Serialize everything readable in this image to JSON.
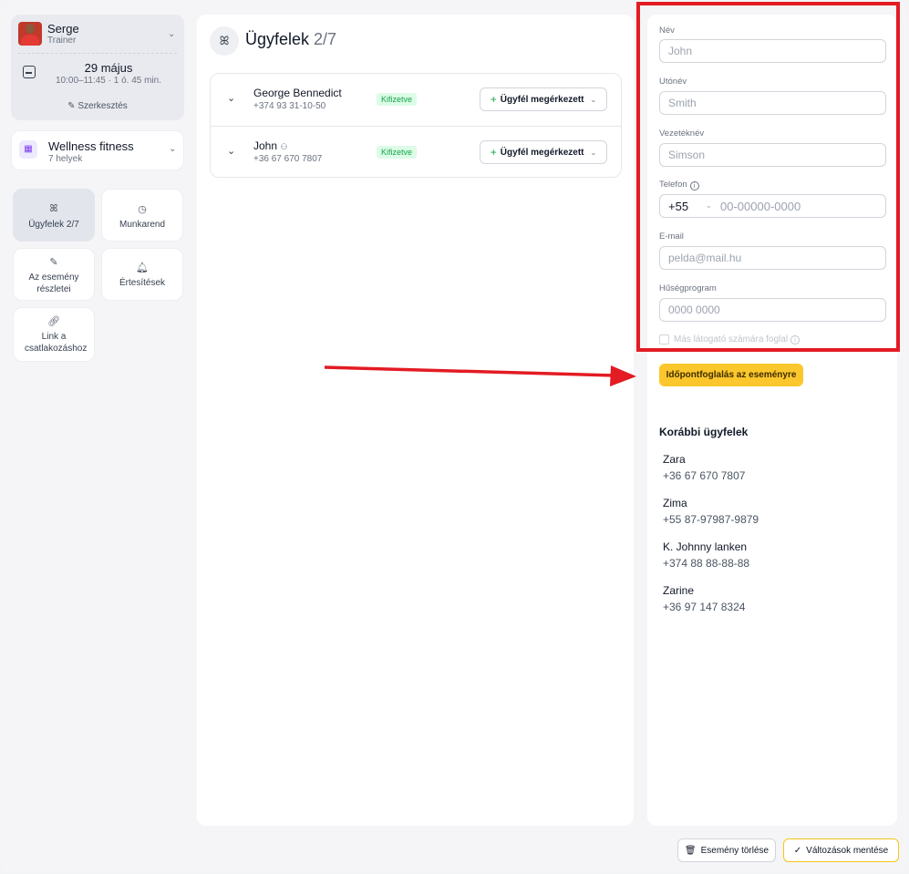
{
  "trainer": {
    "name": "Serge",
    "role": "Trainer"
  },
  "schedule": {
    "date": "29 május",
    "time": "10:00–11:45 · 1 ó. 45 min.",
    "edit_label": "Szerkesztés"
  },
  "event": {
    "name": "Wellness fitness",
    "places": "7 helyek"
  },
  "menu": {
    "clients": "Ügyfelek 2/7",
    "schedule": "Munkarend",
    "details": "Az esemény részletei",
    "notifications": "Értesítések",
    "join_link": "Link a csatlakozáshoz"
  },
  "clients_panel": {
    "title": "Ügyfelek",
    "count": "2/7",
    "rows": [
      {
        "name": "George Bennedict",
        "phone": "+374 93 31-10-50",
        "status": "Kifizetve",
        "action": "Ügyfél megérkezett"
      },
      {
        "name": "John",
        "phone": "+36 67 670 7807",
        "status": "Kifizetve",
        "action": "Ügyfél megérkezett"
      }
    ]
  },
  "form": {
    "first_name_label": "Név",
    "first_name_placeholder": "John",
    "middle_name_label": "Utónév",
    "middle_name_placeholder": "Smith",
    "last_name_label": "Vezetéknév",
    "last_name_placeholder": "Simson",
    "phone_label": "Telefon",
    "phone_code": "+55",
    "phone_placeholder": "00-00000-0000",
    "email_label": "E-mail",
    "email_placeholder": "pelda@mail.hu",
    "loyalty_label": "Hűségprogram",
    "loyalty_placeholder": "0000 0000",
    "other_visitor_label": "Más látogató számára foglal",
    "book_button": "Időpontfoglalás az eseményre"
  },
  "previous_clients": {
    "title": "Korábbi ügyfelek",
    "items": [
      {
        "name": "Zara",
        "phone": "+36 67 670 7807"
      },
      {
        "name": "Zima",
        "phone": "+55 87-97987-9879"
      },
      {
        "name": "K. Johnny lanken",
        "phone": "+374 88 88-88-88"
      },
      {
        "name": "Zarine",
        "phone": "+36 97 147 8324"
      }
    ]
  },
  "footer": {
    "delete_label": "Esemény törlése",
    "save_label": "Változások mentése"
  },
  "colors": {
    "accent_yellow": "#fbc72c",
    "paid_green": "#16a34a",
    "annotation_red": "#e31b23"
  }
}
